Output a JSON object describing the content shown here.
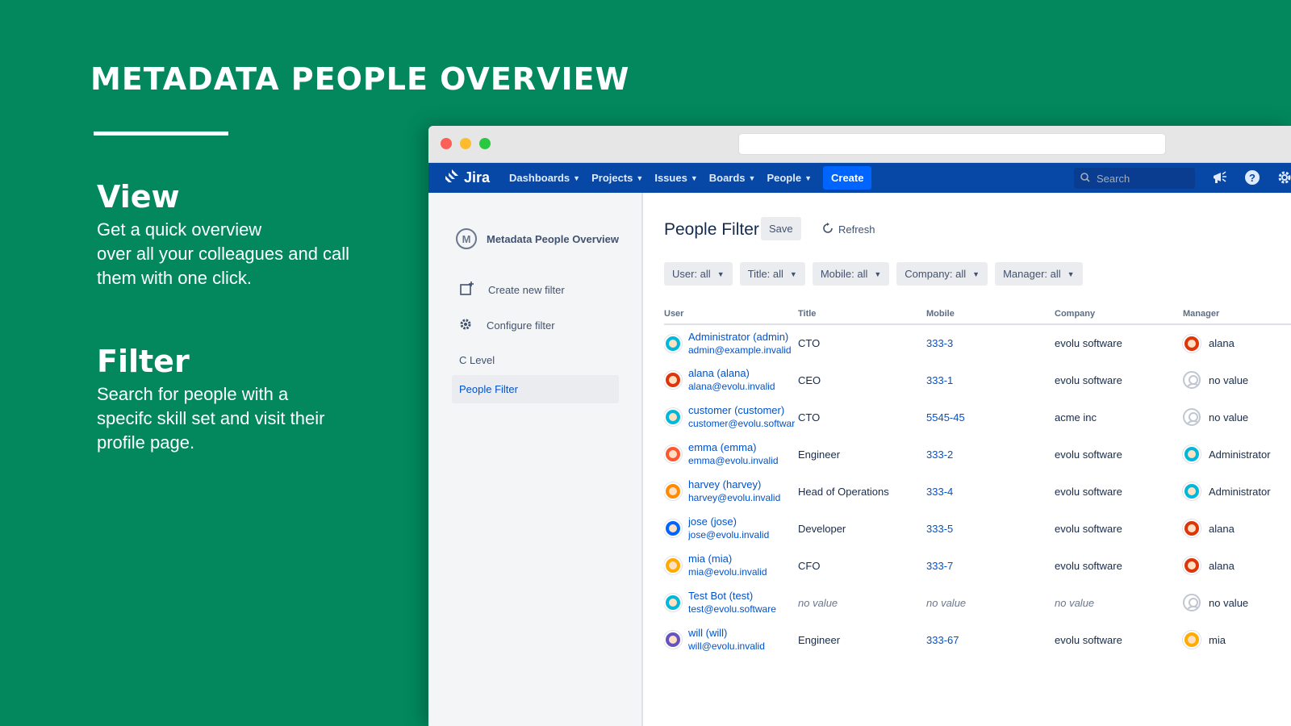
{
  "hero": {
    "title": "METADATA PEOPLE OVERVIEW"
  },
  "features": [
    {
      "heading": "View",
      "text": "Get a quick overview\nover all your colleagues and call\nthem with one click."
    },
    {
      "heading": "Filter",
      "text": "Search for people with a\nspecifc skill set and visit their\nprofile page."
    }
  ],
  "nav": {
    "logo": "Jira",
    "items": [
      "Dashboards",
      "Projects",
      "Issues",
      "Boards",
      "People"
    ],
    "create": "Create",
    "search_placeholder": "Search"
  },
  "sidebar": {
    "app_name": "Metadata People Overview",
    "app_logo": "M",
    "create_filter": "Create new filter",
    "configure_filter": "Configure filter",
    "section": "C Level",
    "active_item": "People Filter"
  },
  "main": {
    "title": "People Filter",
    "save": "Save",
    "refresh": "Refresh",
    "filters": [
      "User: all",
      "Title: all",
      "Mobile: all",
      "Company: all",
      "Manager: all"
    ],
    "columns": [
      "User",
      "Title",
      "Mobile",
      "Company",
      "Manager"
    ]
  },
  "people": [
    {
      "name": "Administrator (admin)",
      "email": "admin@example.invalid",
      "title": "CTO",
      "mobile": "333-3",
      "company": "evolu software",
      "manager": "alana",
      "avatar_color": "#00b8d9",
      "mgr_color": "#de350b",
      "mgr_empty": false
    },
    {
      "name": "alana (alana)",
      "email": "alana@evolu.invalid",
      "title": "CEO",
      "mobile": "333-1",
      "company": "evolu software",
      "manager": "no value",
      "avatar_color": "#de350b",
      "mgr_color": "",
      "mgr_empty": true
    },
    {
      "name": "customer (customer)",
      "email": "customer@evolu.softwar",
      "title": "CTO",
      "mobile": "5545-45",
      "company": "acme inc",
      "manager": "no value",
      "avatar_color": "#00b8d9",
      "mgr_color": "",
      "mgr_empty": true
    },
    {
      "name": "emma (emma)",
      "email": "emma@evolu.invalid",
      "title": "Engineer",
      "mobile": "333-2",
      "company": "evolu software",
      "manager": "Administrator",
      "avatar_color": "#ff5630",
      "mgr_color": "#00b8d9",
      "mgr_empty": false
    },
    {
      "name": "harvey (harvey)",
      "email": "harvey@evolu.invalid",
      "title": "Head of Operations",
      "mobile": "333-4",
      "company": "evolu software",
      "manager": "Administrator",
      "avatar_color": "#ff8b00",
      "mgr_color": "#00b8d9",
      "mgr_empty": false
    },
    {
      "name": "jose (jose)",
      "email": "jose@evolu.invalid",
      "title": "Developer",
      "mobile": "333-5",
      "company": "evolu software",
      "manager": "alana",
      "avatar_color": "#0065ff",
      "mgr_color": "#de350b",
      "mgr_empty": false
    },
    {
      "name": "mia (mia)",
      "email": "mia@evolu.invalid",
      "title": "CFO",
      "mobile": "333-7",
      "company": "evolu software",
      "manager": "alana",
      "avatar_color": "#ffab00",
      "mgr_color": "#de350b",
      "mgr_empty": false
    },
    {
      "name": "Test Bot (test)",
      "email": "test@evolu.software",
      "title": "no value",
      "mobile": "no value",
      "company": "no value",
      "manager": "no value",
      "avatar_color": "#00b8d9",
      "mgr_color": "",
      "mgr_empty": true,
      "empty_fields": true
    },
    {
      "name": "will (will)",
      "email": "will@evolu.invalid",
      "title": "Engineer",
      "mobile": "333-67",
      "company": "evolu software",
      "manager": "mia",
      "avatar_color": "#6554c0",
      "mgr_color": "#ffab00",
      "mgr_empty": false
    }
  ]
}
